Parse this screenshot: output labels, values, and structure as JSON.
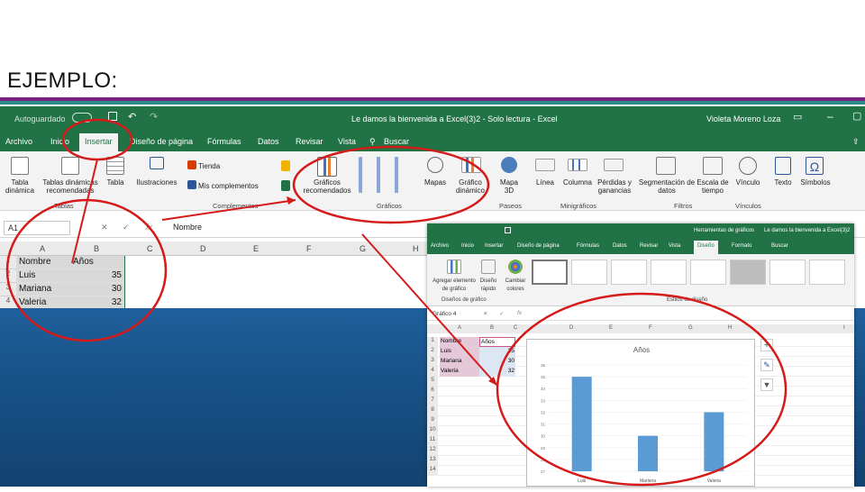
{
  "slide": {
    "title": "EJEMPLO:"
  },
  "colors": {
    "excel_green": "#217346",
    "chart_bar": "#5b9bd5",
    "annotation_red": "#d51a1a",
    "slide_purple": "#7b2180",
    "slide_teal": "#2a8c86"
  },
  "excel": {
    "titlebar": {
      "autosave": "Autoguardado",
      "title": "Le damos la bienvenida a Excel(3)2  -  Solo lectura  -  Excel",
      "user": "Violeta Moreno Loza"
    },
    "tabs": [
      "Archivo",
      "Inicio",
      "Insertar",
      "Diseño de página",
      "Fórmulas",
      "Datos",
      "Revisar",
      "Vista",
      "Buscar"
    ],
    "ribbon": {
      "pivot": "Tabla dinámica",
      "recommended_pivot": "Tablas dinámicas recomendadas",
      "table": "Tabla",
      "illustrations": "Ilustraciones",
      "store": "Tienda",
      "my_addins": "Mis complementos",
      "recommended_charts": "Gráficos recomendados",
      "maps": "Mapas",
      "pivot_chart": "Gráfico dinámico",
      "map3d": "Mapa 3D",
      "line": "Línea",
      "column": "Columna",
      "winloss": "Pérdidas y ganancias",
      "slicer": "Segmentación de datos",
      "timeline": "Escala de tiempo",
      "link": "Vínculo",
      "text": "Texto",
      "symbols": "Símbolos",
      "groups": {
        "tables": "Tablas",
        "addins": "Complementos",
        "charts": "Gráficos",
        "tours": "Paseos",
        "sparklines": "Minigráficos",
        "filters": "Filtros",
        "links": "Vínculos"
      }
    },
    "formula": {
      "namebox": "A1",
      "value": "Nombre"
    },
    "columns": [
      "A",
      "B",
      "C",
      "D",
      "E",
      "F",
      "G",
      "H"
    ],
    "table": {
      "headers": [
        "Nombre",
        "Años"
      ],
      "rows": [
        [
          "Luis",
          "35"
        ],
        [
          "Mariana",
          "30"
        ],
        [
          "Valeria",
          "32"
        ]
      ]
    }
  },
  "excel2": {
    "titlebar": {
      "tools": "Herramientas de gráficos",
      "title": "Le damos la bienvenida a Excel(3)2"
    },
    "tabs": [
      "Archivo",
      "Inicio",
      "Insertar",
      "Diseño de página",
      "Fórmulas",
      "Datos",
      "Revisar",
      "Vista",
      "Diseño",
      "Formato",
      "Buscar"
    ],
    "ribbon": {
      "add_element": "Agregar elemento de gráfico",
      "layout": "Diseño rápido",
      "colors": "Cambiar colores",
      "group_layouts": "Diseños de gráfico",
      "group_styles": "Estilos de diseño"
    },
    "namebox": "Gráfico 4",
    "columns": [
      "A",
      "B",
      "C",
      "D",
      "E",
      "F",
      "G",
      "H",
      "I"
    ],
    "row_numbers": [
      "1",
      "2",
      "3",
      "4",
      "5",
      "6",
      "7",
      "8",
      "9",
      "10",
      "11",
      "12",
      "13",
      "14"
    ]
  },
  "chart_data": {
    "type": "bar",
    "title": "Años",
    "categories": [
      "Luis",
      "Mariana",
      "Valeria"
    ],
    "values": [
      35,
      30,
      32
    ],
    "ylim": [
      27,
      36
    ],
    "yticks": [
      36,
      35,
      34,
      33,
      32,
      31,
      30,
      29,
      28,
      27
    ]
  }
}
